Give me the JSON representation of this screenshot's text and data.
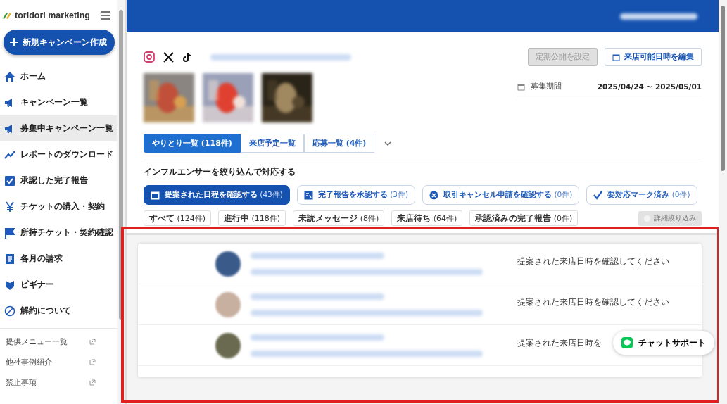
{
  "sidebar": {
    "logo": "toridori marketing",
    "new_button": "新規キャンペーン作成",
    "items": [
      {
        "label": "ホーム",
        "selected": false
      },
      {
        "label": "キャンペーン一覧",
        "selected": false
      },
      {
        "label": "募集中キャンペーン一覧",
        "selected": true
      },
      {
        "label": "レポートのダウンロード",
        "selected": false
      },
      {
        "label": "承認した完了報告",
        "selected": false
      },
      {
        "label": "チケットの購入・契約",
        "selected": false
      },
      {
        "label": "所持チケット・契約確認",
        "selected": false
      },
      {
        "label": "各月の請求",
        "selected": false
      },
      {
        "label": "ビギナー",
        "selected": false
      },
      {
        "label": "解約について",
        "selected": false
      }
    ],
    "links": [
      "提供メニュー一覧",
      "他社事例紹介",
      "禁止事項"
    ]
  },
  "campaign": {
    "schedule_button": {
      "label": "定期公開を設定",
      "disabled": true
    },
    "edit_button": "来店可能日時を編集",
    "period_label": "募集期間",
    "period_value": "2025/04/24 ~ 2025/05/01"
  },
  "tabs": [
    {
      "label": "やりとり一覧 (118件)",
      "selected": true
    },
    {
      "label": "来店予定一覧",
      "selected": false
    },
    {
      "label": "応募一覧 (4件)",
      "selected": false
    }
  ],
  "filter_heading": "インフルエンサーを絞り込んで対応する",
  "actions": [
    {
      "label": "提案された日程を確認する",
      "count": "(43件)",
      "selected": true
    },
    {
      "label": "完了報告を承認する",
      "count": "(3件)",
      "selected": false
    },
    {
      "label": "取引キャンセル申請を確認する",
      "count": "(0件)",
      "selected": false
    },
    {
      "label": "要対応マーク済み",
      "count": "(0件)",
      "selected": false
    }
  ],
  "chips": [
    {
      "label": "すべて",
      "count": "(124件)"
    },
    {
      "label": "進行中",
      "count": "(118件)"
    },
    {
      "label": "未読メッセージ",
      "count": "(8件)"
    },
    {
      "label": "来店待ち",
      "count": "(64件)"
    },
    {
      "label": "承認済みの完了報告",
      "count": "(0件)"
    }
  ],
  "detail_filter": "詳細絞り込み",
  "rows": [
    {
      "status": "提案された来店日時を確認してください"
    },
    {
      "status": "提案された来店日時を確認してください"
    },
    {
      "status": "提案された来店日時を"
    }
  ],
  "chat_button": "チャットサポート"
}
